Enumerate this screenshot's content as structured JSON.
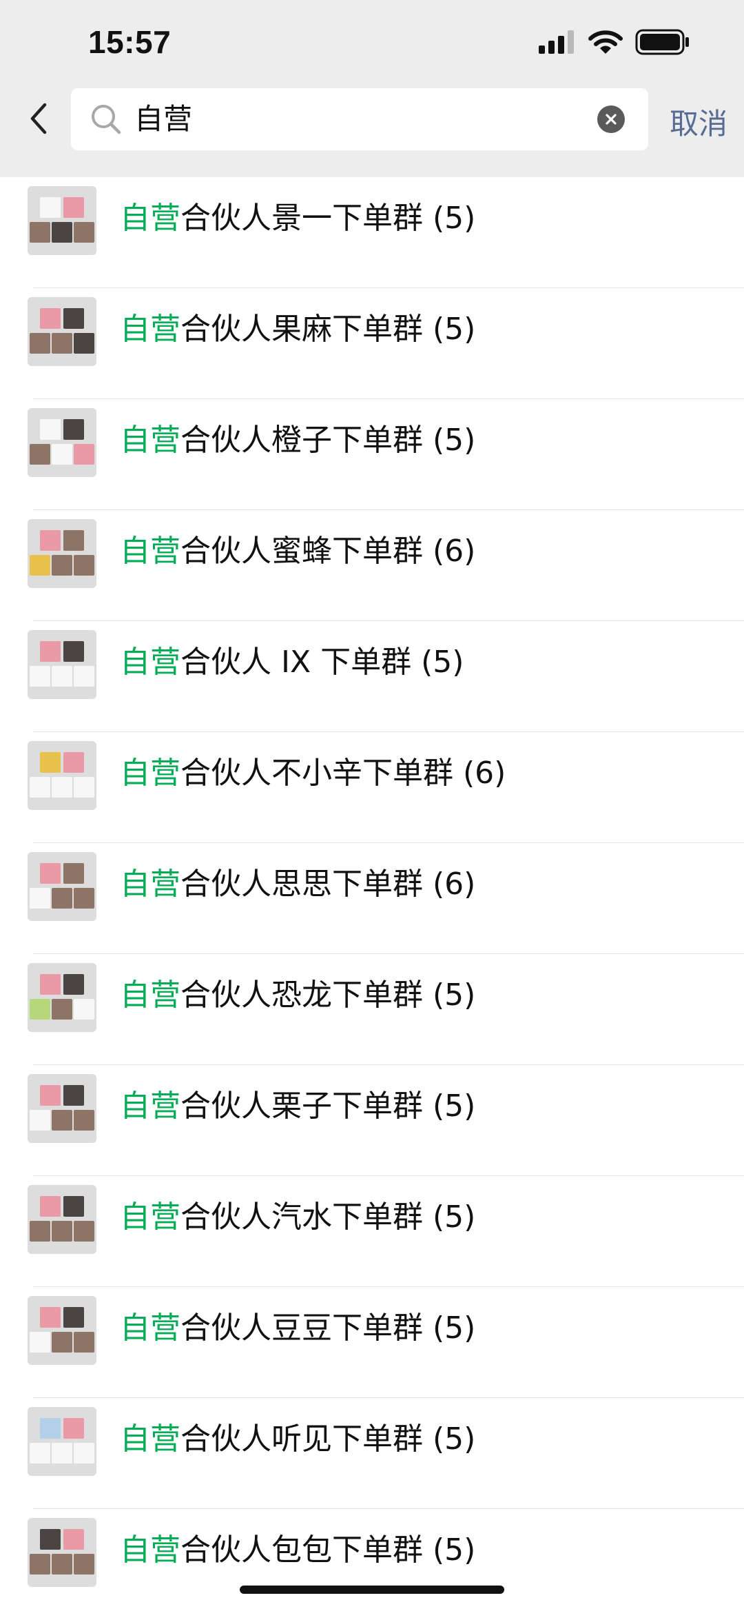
{
  "status_bar": {
    "time": "15:57",
    "icons": [
      "signal-icon",
      "wifi-icon",
      "battery-icon"
    ]
  },
  "search": {
    "query": "自营",
    "cancel_label": "取消",
    "accent_color": "#06ad56",
    "link_color": "#576b95"
  },
  "results": [
    {
      "highlight": "自营",
      "rest": "合伙人景一下单群 (5)",
      "avatar_pattern": [
        "light",
        "pink",
        "tan",
        "dark",
        "tan",
        "tan"
      ]
    },
    {
      "highlight": "自营",
      "rest": "合伙人果麻下单群 (5)",
      "avatar_pattern": [
        "pink",
        "dark",
        "tan",
        "tan",
        "dark",
        "tan"
      ]
    },
    {
      "highlight": "自营",
      "rest": "合伙人橙子下单群 (5)",
      "avatar_pattern": [
        "light",
        "dark",
        "tan",
        "light",
        "pink",
        "pink"
      ]
    },
    {
      "highlight": "自营",
      "rest": "合伙人蜜蜂下单群 (6)",
      "avatar_pattern": [
        "pink",
        "tan",
        "yellow",
        "tan",
        "tan",
        "yellow"
      ]
    },
    {
      "highlight": "自营",
      "rest": "合伙人 IX 下单群 (5)",
      "avatar_pattern": [
        "pink",
        "dark",
        "light",
        "light",
        "light",
        "light"
      ]
    },
    {
      "highlight": "自营",
      "rest": "合伙人不小辛下单群 (6)",
      "avatar_pattern": [
        "yellow",
        "pink",
        "light",
        "light",
        "light",
        "light"
      ]
    },
    {
      "highlight": "自营",
      "rest": "合伙人思思下单群 (6)",
      "avatar_pattern": [
        "pink",
        "tan",
        "light",
        "tan",
        "tan",
        "purple"
      ]
    },
    {
      "highlight": "自营",
      "rest": "合伙人恐龙下单群 (5)",
      "avatar_pattern": [
        "pink",
        "dark",
        "green",
        "tan",
        "light",
        "light"
      ]
    },
    {
      "highlight": "自营",
      "rest": "合伙人栗子下单群 (5)",
      "avatar_pattern": [
        "pink",
        "dark",
        "light",
        "tan",
        "tan",
        "tan"
      ]
    },
    {
      "highlight": "自营",
      "rest": "合伙人汽水下单群 (5)",
      "avatar_pattern": [
        "pink",
        "dark",
        "tan",
        "tan",
        "tan",
        "tan"
      ]
    },
    {
      "highlight": "自营",
      "rest": "合伙人豆豆下单群 (5)",
      "avatar_pattern": [
        "pink",
        "dark",
        "light",
        "tan",
        "tan",
        "tan"
      ]
    },
    {
      "highlight": "自营",
      "rest": "合伙人听见下单群 (5)",
      "avatar_pattern": [
        "blue",
        "pink",
        "light",
        "light",
        "light",
        "light"
      ]
    },
    {
      "highlight": "自营",
      "rest": "合伙人包包下单群 (5)",
      "avatar_pattern": [
        "dark",
        "pink",
        "tan",
        "tan",
        "tan",
        "tan"
      ]
    }
  ]
}
